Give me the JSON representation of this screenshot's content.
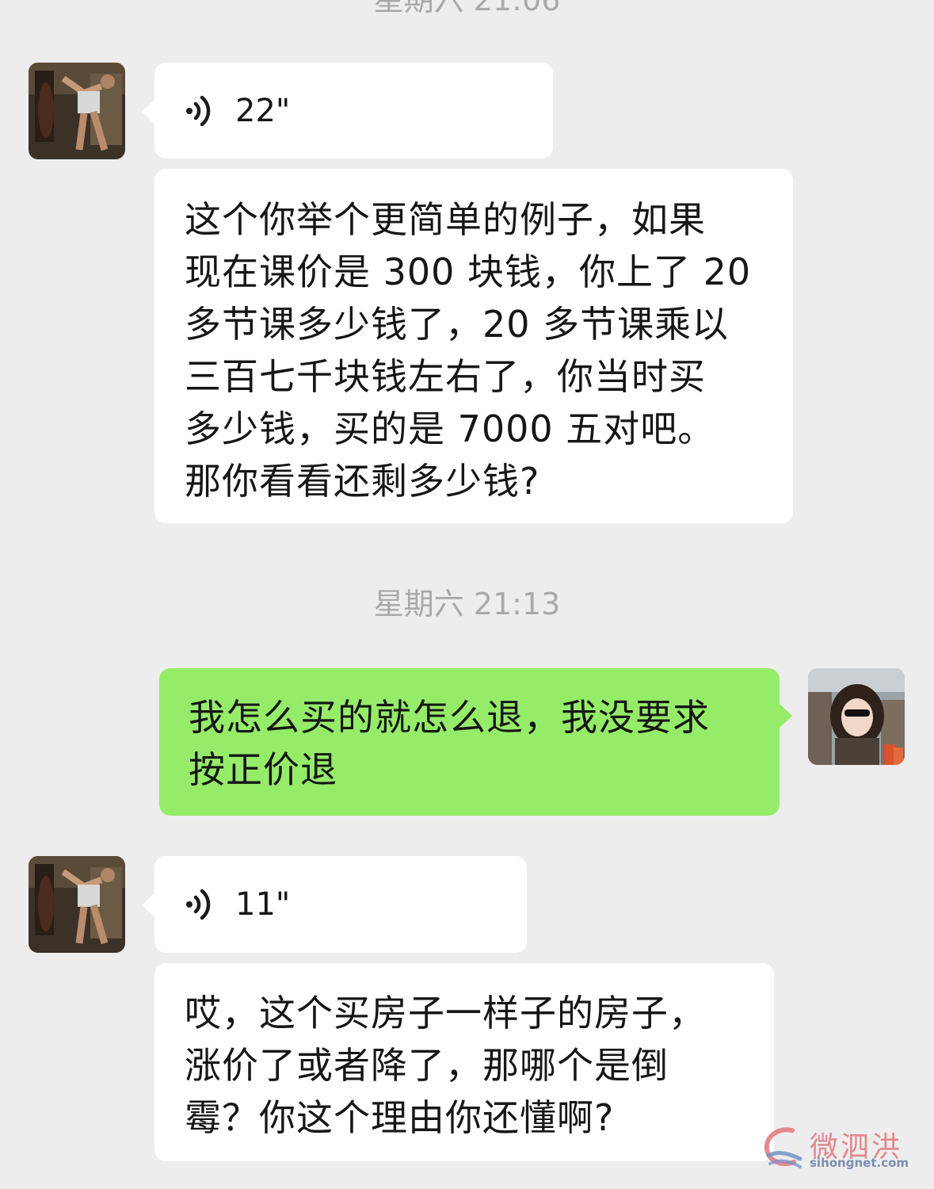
{
  "timestamps": {
    "top": "星期六 21:06",
    "middle": "星期六 21:13"
  },
  "messages": [
    {
      "sender": "other",
      "type": "voice",
      "duration": "22\""
    },
    {
      "sender": "other",
      "type": "text",
      "text": "这个你举个更简单的例子，如果\n现在课价是 300 块钱，你上了 20\n多节课多少钱了，20 多节课乘以\n三百七千块钱左右了，你当时买\n多少钱，买的是 7000 五对吧。\n那你看看还剩多少钱?"
    },
    {
      "sender": "self",
      "type": "text",
      "text": "我怎么买的就怎么退，我没要求\n按正价退"
    },
    {
      "sender": "other",
      "type": "voice",
      "duration": "11\""
    },
    {
      "sender": "other",
      "type": "text",
      "text": "哎，这个买房子一样子的房子，\n涨价了或者降了，那哪个是倒\n霉？你这个理由你还懂啊?"
    }
  ],
  "watermark": {
    "title": "微泗洪",
    "url": "sihongnet.com"
  },
  "colors": {
    "background": "#ededed",
    "other_bubble": "#ffffff",
    "self_bubble": "#95ec69",
    "timestamp": "#a9a9a9"
  }
}
